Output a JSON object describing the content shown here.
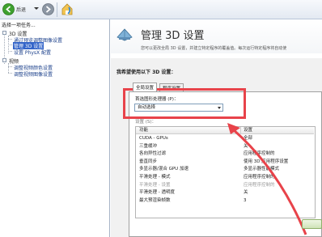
{
  "toolbar": {
    "back_label": "后退"
  },
  "task_panel": {
    "header": "选择一项任务...",
    "categories": [
      {
        "label": "3D 设置",
        "items": [
          {
            "label": "通过预览调整图像设置"
          },
          {
            "label": "管理 3D 设置",
            "selected": true
          },
          {
            "label": "设置 PhysX 配置"
          }
        ]
      },
      {
        "label": "视频",
        "items": [
          {
            "label": "调整视频颜色设置"
          },
          {
            "label": "调整视频图像设置"
          }
        ]
      }
    ]
  },
  "main": {
    "title": "管理 3D 设置",
    "description": "您可以更改全局 3D 设置，并建立特定程序的覆盖值。每次运行特定程序将自动使",
    "section_title": "我希望使用以下 3D 设置：",
    "tabs": [
      {
        "label": "全局设置",
        "active": true
      },
      {
        "label": "程序设置",
        "active": false
      }
    ],
    "processor_label": "首选图形处理器 (P)：",
    "processor_value": "自动选择",
    "settings_label": "设置 (S)：",
    "table": {
      "headers": [
        "功能",
        "设置"
      ],
      "rows": [
        {
          "feature": "CUDA - GPUs",
          "value": "全部",
          "dim": false
        },
        {
          "feature": "三重缓冲",
          "value": "关",
          "dim": false
        },
        {
          "feature": "各向异性过滤",
          "value": "应用程序控制的",
          "dim": false
        },
        {
          "feature": "垂直同步",
          "value": "使用 3D 应用程序设置",
          "dim": false
        },
        {
          "feature": "多显示器/混合 GPU 加速",
          "value": "多显示器性能模式",
          "dim": false
        },
        {
          "feature": "平滑处理 - 模式",
          "value": "应用程序控制的",
          "dim": false
        },
        {
          "feature": "平滑处理 - 设置",
          "value": "应用程序控制的",
          "dim": true
        },
        {
          "feature": "平滑处理 - 透明度",
          "value": "关",
          "dim": false
        },
        {
          "feature": "最大预渲染帧数",
          "value": "3",
          "dim": false
        }
      ]
    }
  },
  "colors": {
    "annotation": "#e8434a",
    "selection": "#3465c9",
    "link": "#1a3f8a"
  }
}
